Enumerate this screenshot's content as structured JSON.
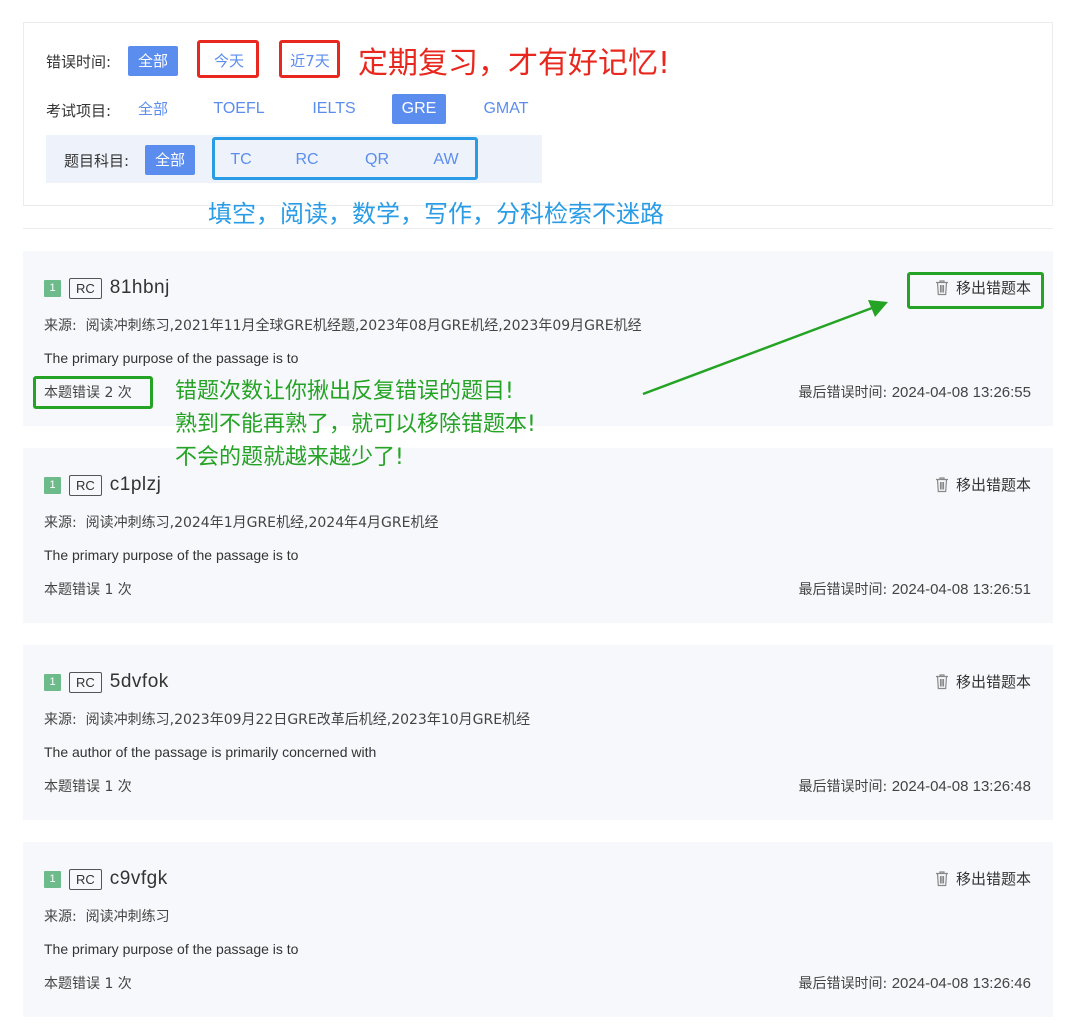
{
  "filters": {
    "time": {
      "label": "错误时间:",
      "options": [
        "全部",
        "今天",
        "近7天"
      ],
      "active": "全部"
    },
    "exam": {
      "label": "考试项目:",
      "options": [
        "全部",
        "TOEFL",
        "IELTS",
        "GRE",
        "GMAT"
      ],
      "active": "GRE"
    },
    "subject": {
      "label": "题目科目:",
      "options": [
        "全部",
        "TC",
        "RC",
        "QR",
        "AW"
      ],
      "active": "全部"
    }
  },
  "annotations": {
    "time_tip": "定期复习，才有好记忆!",
    "subject_tip": "填空，阅读，数学，写作，分科检索不迷路",
    "error_tip_1": "错题次数让你揪出反复错误的题目!",
    "error_tip_2": "熟到不能再熟了，就可以移除错题本!",
    "error_tip_3": "不会的题就越来越少了!"
  },
  "colors": {
    "accent": "#5b8def",
    "annotation_red": "#e8281e",
    "annotation_blue": "#2a9ce6",
    "annotation_green": "#24a324",
    "badge_green": "#6dbb8a"
  },
  "remove_label": "移出错题本",
  "remove_icon": "trash-icon",
  "source_prefix": "来源:",
  "last_time_prefix": "最后错误时间:",
  "items": [
    {
      "num": "1",
      "type": "RC",
      "id": "81hbnj",
      "source": "阅读冲刺练习,2021年11月全球GRE机经题,2023年08月GRE机经,2023年09月GRE机经",
      "stem": "The primary purpose of the passage is to",
      "errors": "本题错误 2 次",
      "last_time": "2024-04-08 13:26:55"
    },
    {
      "num": "1",
      "type": "RC",
      "id": "c1plzj",
      "source": "阅读冲刺练习,2024年1月GRE机经,2024年4月GRE机经",
      "stem": "The primary purpose of the passage is to",
      "errors": "本题错误 1 次",
      "last_time": "2024-04-08 13:26:51"
    },
    {
      "num": "1",
      "type": "RC",
      "id": "5dvfok",
      "source": "阅读冲刺练习,2023年09月22日GRE改革后机经,2023年10月GRE机经",
      "stem": "The author of the passage is primarily concerned with",
      "errors": "本题错误 1 次",
      "last_time": "2024-04-08 13:26:48"
    },
    {
      "num": "1",
      "type": "RC",
      "id": "c9vfgk",
      "source": "阅读冲刺练习",
      "stem": "The primary purpose of the passage is to",
      "errors": "本题错误 1 次",
      "last_time": "2024-04-08 13:26:46"
    }
  ]
}
